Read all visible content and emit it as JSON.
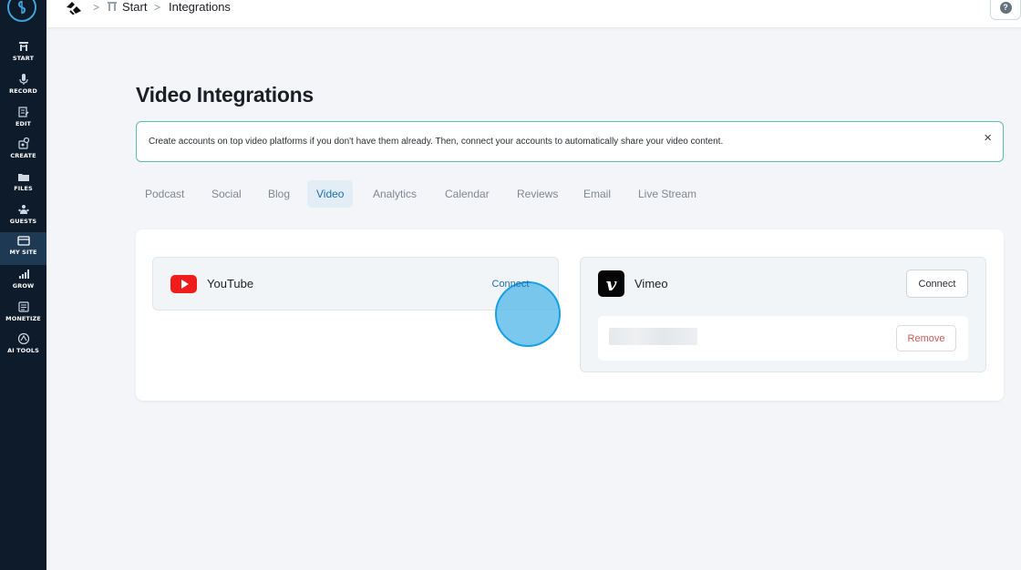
{
  "sidebar": {
    "items": [
      {
        "label": "START",
        "icon": "start-icon"
      },
      {
        "label": "RECORD",
        "icon": "microphone-icon"
      },
      {
        "label": "EDIT",
        "icon": "edit-icon"
      },
      {
        "label": "CREATE",
        "icon": "create-icon"
      },
      {
        "label": "FILES",
        "icon": "folder-icon"
      },
      {
        "label": "GUESTS",
        "icon": "guests-icon"
      },
      {
        "label": "MY SITE",
        "icon": "site-icon",
        "active": true
      },
      {
        "label": "GROW",
        "icon": "grow-icon"
      },
      {
        "label": "MONETIZE",
        "icon": "monetize-icon"
      },
      {
        "label": "AI TOOLS",
        "icon": "ai-tools-icon"
      }
    ]
  },
  "breadcrumb": {
    "sep1": ">",
    "start": "Start",
    "sep2": ">",
    "current": "Integrations"
  },
  "help": {
    "glyph": "?"
  },
  "page": {
    "title": "Video Integrations"
  },
  "banner": {
    "text": "Create accounts on top video platforms if you don't have them already. Then, connect your accounts to automatically share your video content.",
    "close": "×"
  },
  "tabs": [
    {
      "label": "Podcast"
    },
    {
      "label": "Social"
    },
    {
      "label": "Blog"
    },
    {
      "label": "Video",
      "active": true
    },
    {
      "label": "Analytics"
    },
    {
      "label": "Calendar"
    },
    {
      "label": "Reviews"
    },
    {
      "label": "Email"
    },
    {
      "label": "Live Stream"
    }
  ],
  "integrations": {
    "youtube": {
      "name": "YouTube",
      "connect_label": "Connect"
    },
    "vimeo": {
      "name": "Vimeo",
      "icon_letter": "v",
      "connect_label": "Connect",
      "remove_label": "Remove"
    }
  },
  "colors": {
    "sidebar_bg": "#0e1b2b",
    "accent": "#1f6fad",
    "banner_border": "#5bbcb0",
    "youtube_red": "#ee1c1b",
    "highlight": "#4fb6e8"
  }
}
